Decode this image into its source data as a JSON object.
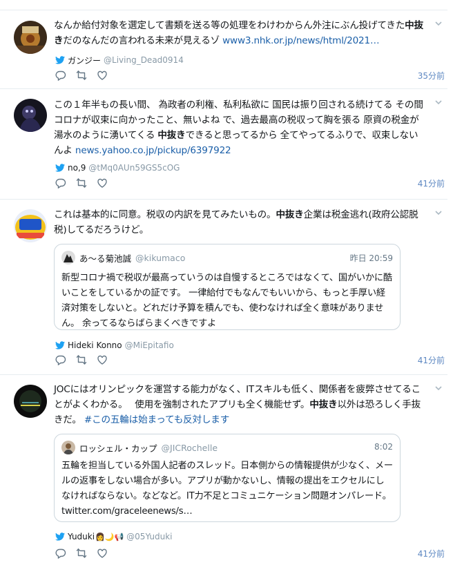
{
  "tweets": [
    {
      "text_before": "なんか給付対象を選定して書類を送る等の処理をわけわからん外注にぶん投げてきた",
      "highlight": "中抜き",
      "text_after": "だのなんだの言われる未来が見えるゾ ",
      "link": "www3.nhk.or.jp/news/html/2021…",
      "author": "ガンジー",
      "handle": "@Living_Dead0914",
      "time": "35分前"
    },
    {
      "text_before": "この１年半もの長い間、 為政者の利権、私利私欲に 国民は振り回される続けてる その間 コロナが収束に向かったこと、無いよね で、過去最高の税収って胸を張る 原資の税金が湯水のように湧いてくる ",
      "highlight": "中抜き",
      "text_after": "できると思ってるから 全てやってるふりで、収束しないんよ ",
      "link": "news.yahoo.co.jp/pickup/6397922",
      "author": "no,9",
      "handle": "@tMq0AUn59GS5cOG",
      "time": "41分前"
    },
    {
      "text_before": "これは基本的に同意。税収の内訳を見てみたいもの。",
      "highlight": "中抜き",
      "text_after": "企業は税金逃れ(政府公認脱税)してるだろうけど。",
      "quote": {
        "name": "あ〜る菊池誠",
        "handle": "@kikumaco",
        "time": "昨日 20:59",
        "text": "新型コロナ禍で税収が最高っていうのは自慢するところではなくて、国がいかに酷いことをしているかの証です。 一律給付でもなんでもいいから、もっと手厚い経済対策をしないと。どれだけ予算を積んでも、使わなければ全く意味がありません。 余ってるならばらまくべきですよ"
      },
      "author": "Hideki Konno",
      "handle": "@MiEpitafio",
      "time": "41分前"
    },
    {
      "text_before": "JOCにはオリンピックを運営する能力がなく、ITスキルも低く、関係者を疲弊させてることがよくわかる。　 使用を強制されたアプリも全く機能せず。",
      "highlight": "中抜き",
      "text_after": "以外は恐ろしく手抜きだ。 ",
      "link": "#この五輪は始まっても反対します",
      "quote": {
        "name": "ロッシェル・カップ",
        "handle": "@JICRochelle",
        "time": "8:02",
        "text": "五輪を担当している外国人記者のスレッド。日本側からの情報提供が少なく、メールの返事をしない場合が多い。アプリが動かないし、情報の提出をエクセルにしなければならない。などなど。IT力不足とコミュニケーション問題オンパレード。 twitter.com/graceleenews/s…"
      },
      "author": "Yuduki",
      "author_emoji": "👩🌙📢",
      "handle": "@05Yuduki",
      "time": "41分前"
    }
  ]
}
